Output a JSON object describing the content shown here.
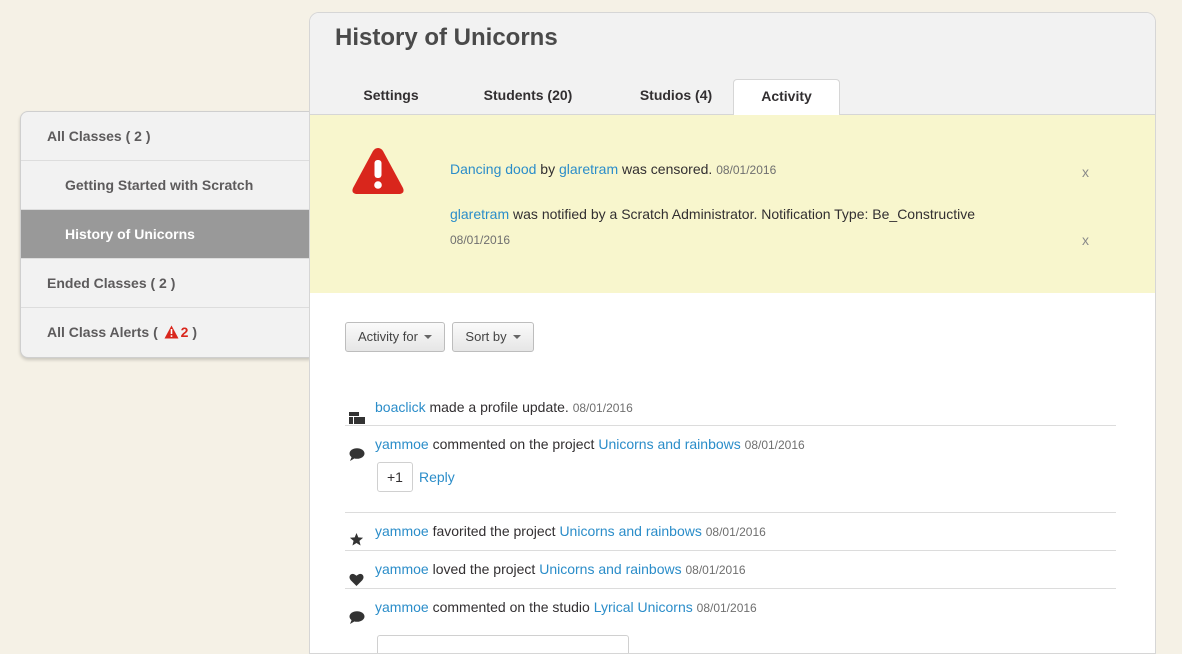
{
  "sidebar": {
    "items": [
      {
        "label": "All Classes ( 2 )"
      },
      {
        "label": "Getting Started with Scratch"
      },
      {
        "label": "History of Unicorns"
      },
      {
        "label": "Ended Classes ( 2 )"
      }
    ],
    "alerts_prefix": "All Class Alerts (",
    "alerts_count": "2",
    "alerts_suffix": ")"
  },
  "main": {
    "title": "History of Unicorns",
    "tabs": [
      {
        "label": "Settings"
      },
      {
        "label": "Students (20)"
      },
      {
        "label": "Studios (4)"
      },
      {
        "label": "Activity"
      }
    ]
  },
  "alerts": [
    {
      "project": "Dancing dood",
      "by": "by",
      "user": "glaretram",
      "text": "was censored.",
      "date": "08/01/2016",
      "dismiss": "x"
    },
    {
      "user": "glaretram",
      "text": "was notified by a Scratch Administrator. Notification Type: Be_Constructive",
      "date": "08/01/2016",
      "dismiss": "x"
    }
  ],
  "filters": {
    "activity_for": "Activity for",
    "sort_by": "Sort by"
  },
  "feed": [
    {
      "icon": "profile-icon",
      "user": "boaclick",
      "text": "made a profile update.",
      "date": "08/01/2016"
    },
    {
      "icon": "comment-icon",
      "user": "yammoe",
      "text": "commented on the project",
      "target": "Unicorns and rainbows",
      "date": "08/01/2016",
      "plus_one": "+1",
      "reply": "Reply"
    },
    {
      "icon": "star-icon",
      "user": "yammoe",
      "text": "favorited the project",
      "target": "Unicorns and rainbows",
      "date": "08/01/2016"
    },
    {
      "icon": "heart-icon",
      "user": "yammoe",
      "text": "loved the project",
      "target": "Unicorns and rainbows",
      "date": "08/01/2016"
    },
    {
      "icon": "comment-icon",
      "user": "yammoe",
      "text": "commented on the studio",
      "target": "Lyrical Unicorns",
      "date": "08/01/2016"
    }
  ],
  "colors": {
    "link": "#2b8dc9",
    "alert_red": "#d9261c",
    "alert_bg": "#f8f6cd",
    "active_sidebar": "#999999"
  }
}
